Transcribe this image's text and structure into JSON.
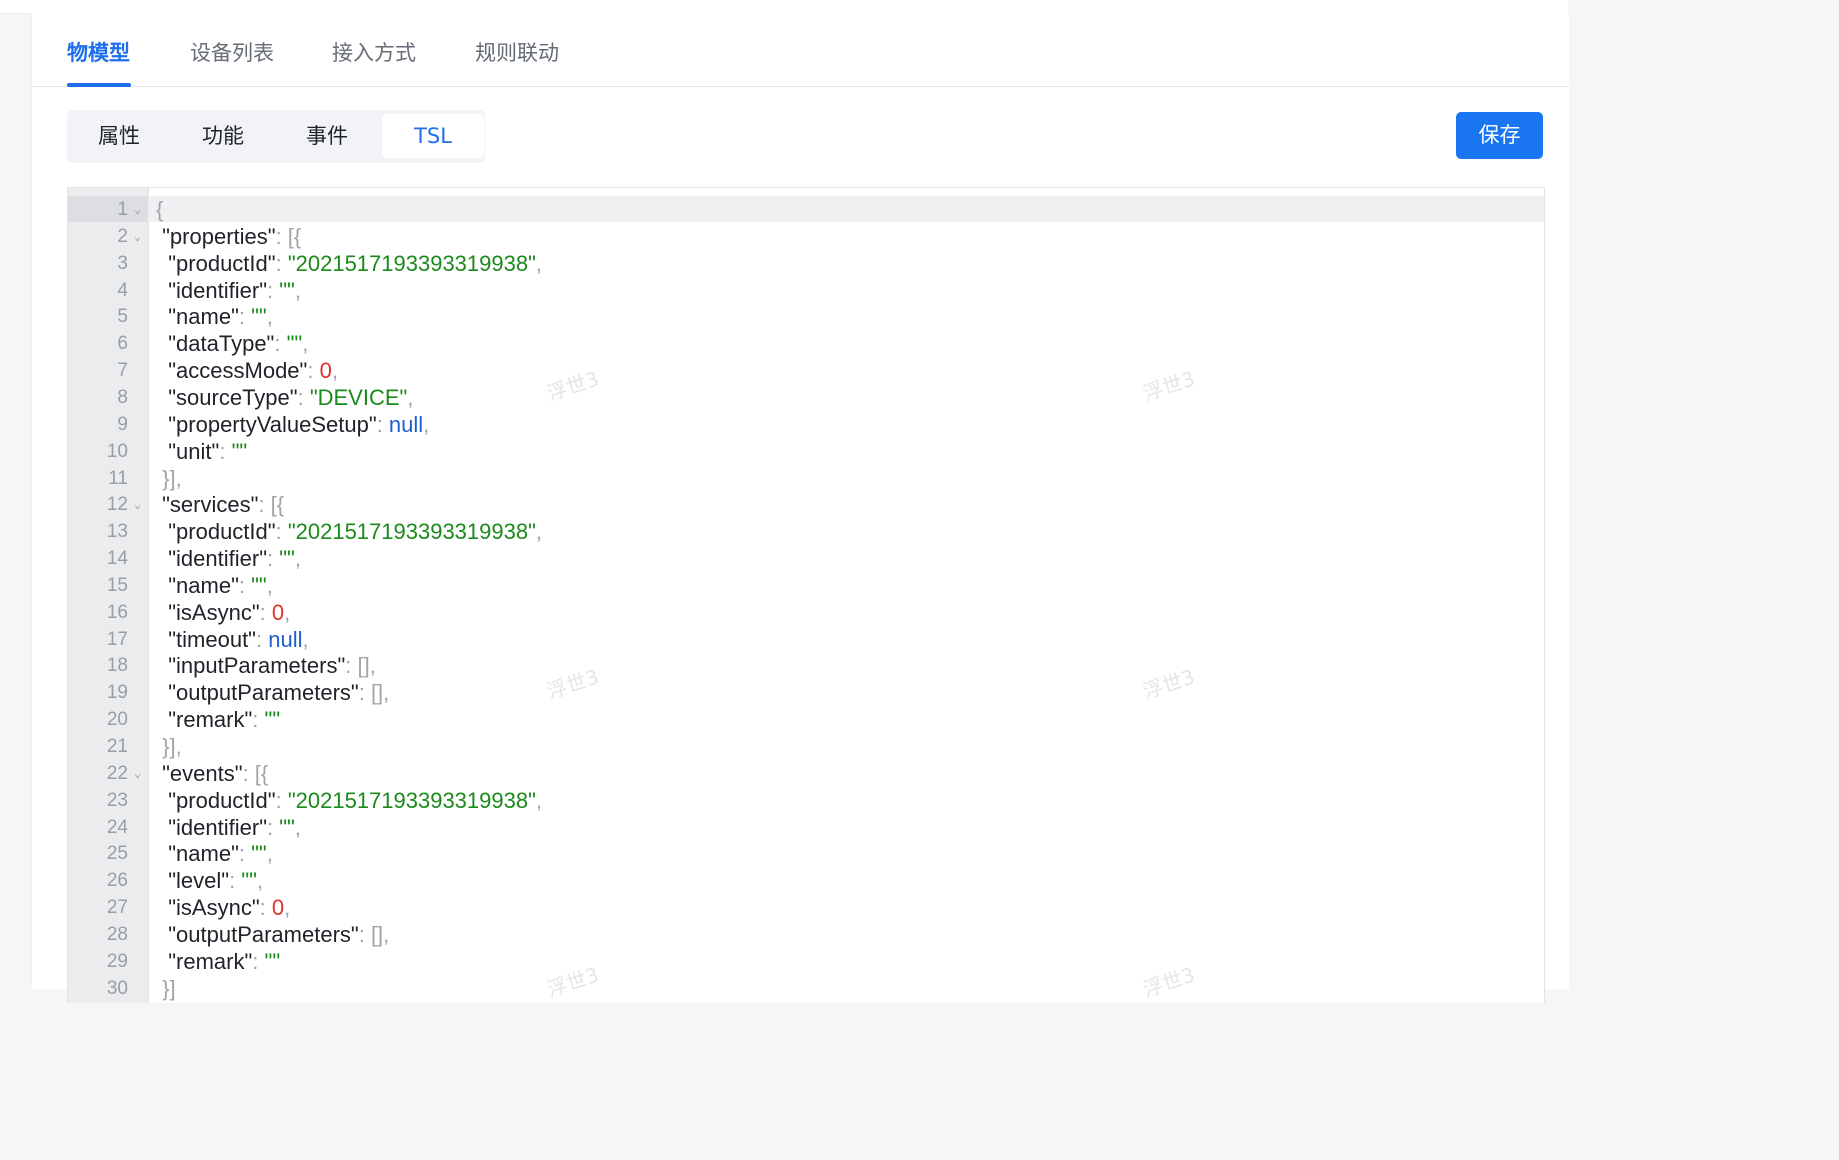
{
  "main_tabs": [
    "物模型",
    "设备列表",
    "接入方式",
    "规则联动"
  ],
  "active_main_tab": "物模型",
  "sub_tabs": [
    "属性",
    "功能",
    "事件",
    "TSL"
  ],
  "active_sub_tab": "TSL",
  "save_label": "保存",
  "watermark": "浮世3",
  "editor": {
    "lines": [
      {
        "n": "1",
        "fold": true,
        "t": [
          [
            "p",
            "{"
          ]
        ]
      },
      {
        "n": "2",
        "fold": true,
        "t": [
          [
            "k",
            " \"properties\""
          ],
          [
            "p",
            ": [{"
          ]
        ]
      },
      {
        "n": "3",
        "t": [
          [
            "k",
            "  \"productId\""
          ],
          [
            "p",
            ": "
          ],
          [
            "s",
            "\"2021517193393319938\""
          ],
          [
            "p",
            ","
          ]
        ]
      },
      {
        "n": "4",
        "t": [
          [
            "k",
            "  \"identifier\""
          ],
          [
            "p",
            ": "
          ],
          [
            "s",
            "\"\""
          ],
          [
            "p",
            ","
          ]
        ]
      },
      {
        "n": "5",
        "t": [
          [
            "k",
            "  \"name\""
          ],
          [
            "p",
            ": "
          ],
          [
            "s",
            "\"\""
          ],
          [
            "p",
            ","
          ]
        ]
      },
      {
        "n": "6",
        "t": [
          [
            "k",
            "  \"dataType\""
          ],
          [
            "p",
            ": "
          ],
          [
            "s",
            "\"\""
          ],
          [
            "p",
            ","
          ]
        ]
      },
      {
        "n": "7",
        "t": [
          [
            "k",
            "  \"accessMode\""
          ],
          [
            "p",
            ": "
          ],
          [
            "n",
            "0"
          ],
          [
            "p",
            ","
          ]
        ]
      },
      {
        "n": "8",
        "t": [
          [
            "k",
            "  \"sourceType\""
          ],
          [
            "p",
            ": "
          ],
          [
            "s",
            "\"DEVICE\""
          ],
          [
            "p",
            ","
          ]
        ]
      },
      {
        "n": "9",
        "t": [
          [
            "k",
            "  \"propertyValueSetup\""
          ],
          [
            "p",
            ": "
          ],
          [
            "l",
            "null"
          ],
          [
            "p",
            ","
          ]
        ]
      },
      {
        "n": "10",
        "t": [
          [
            "k",
            "  \"unit\""
          ],
          [
            "p",
            ": "
          ],
          [
            "s",
            "\"\""
          ]
        ]
      },
      {
        "n": "11",
        "t": [
          [
            "p",
            " }],"
          ]
        ]
      },
      {
        "n": "12",
        "fold": true,
        "t": [
          [
            "k",
            " \"services\""
          ],
          [
            "p",
            ": [{"
          ]
        ]
      },
      {
        "n": "13",
        "t": [
          [
            "k",
            "  \"productId\""
          ],
          [
            "p",
            ": "
          ],
          [
            "s",
            "\"2021517193393319938\""
          ],
          [
            "p",
            ","
          ]
        ]
      },
      {
        "n": "14",
        "t": [
          [
            "k",
            "  \"identifier\""
          ],
          [
            "p",
            ": "
          ],
          [
            "s",
            "\"\""
          ],
          [
            "p",
            ","
          ]
        ]
      },
      {
        "n": "15",
        "t": [
          [
            "k",
            "  \"name\""
          ],
          [
            "p",
            ": "
          ],
          [
            "s",
            "\"\""
          ],
          [
            "p",
            ","
          ]
        ]
      },
      {
        "n": "16",
        "t": [
          [
            "k",
            "  \"isAsync\""
          ],
          [
            "p",
            ": "
          ],
          [
            "n",
            "0"
          ],
          [
            "p",
            ","
          ]
        ]
      },
      {
        "n": "17",
        "t": [
          [
            "k",
            "  \"timeout\""
          ],
          [
            "p",
            ": "
          ],
          [
            "l",
            "null"
          ],
          [
            "p",
            ","
          ]
        ]
      },
      {
        "n": "18",
        "t": [
          [
            "k",
            "  \"inputParameters\""
          ],
          [
            "p",
            ": [],"
          ]
        ]
      },
      {
        "n": "19",
        "t": [
          [
            "k",
            "  \"outputParameters\""
          ],
          [
            "p",
            ": [],"
          ]
        ]
      },
      {
        "n": "20",
        "t": [
          [
            "k",
            "  \"remark\""
          ],
          [
            "p",
            ": "
          ],
          [
            "s",
            "\"\""
          ]
        ]
      },
      {
        "n": "21",
        "t": [
          [
            "p",
            " }],"
          ]
        ]
      },
      {
        "n": "22",
        "fold": true,
        "t": [
          [
            "k",
            " \"events\""
          ],
          [
            "p",
            ": [{"
          ]
        ]
      },
      {
        "n": "23",
        "t": [
          [
            "k",
            "  \"productId\""
          ],
          [
            "p",
            ": "
          ],
          [
            "s",
            "\"2021517193393319938\""
          ],
          [
            "p",
            ","
          ]
        ]
      },
      {
        "n": "24",
        "t": [
          [
            "k",
            "  \"identifier\""
          ],
          [
            "p",
            ": "
          ],
          [
            "s",
            "\"\""
          ],
          [
            "p",
            ","
          ]
        ]
      },
      {
        "n": "25",
        "t": [
          [
            "k",
            "  \"name\""
          ],
          [
            "p",
            ": "
          ],
          [
            "s",
            "\"\""
          ],
          [
            "p",
            ","
          ]
        ]
      },
      {
        "n": "26",
        "t": [
          [
            "k",
            "  \"level\""
          ],
          [
            "p",
            ": "
          ],
          [
            "s",
            "\"\""
          ],
          [
            "p",
            ","
          ]
        ]
      },
      {
        "n": "27",
        "t": [
          [
            "k",
            "  \"isAsync\""
          ],
          [
            "p",
            ": "
          ],
          [
            "n",
            "0"
          ],
          [
            "p",
            ","
          ]
        ]
      },
      {
        "n": "28",
        "t": [
          [
            "k",
            "  \"outputParameters\""
          ],
          [
            "p",
            ": [],"
          ]
        ]
      },
      {
        "n": "29",
        "t": [
          [
            "k",
            "  \"remark\""
          ],
          [
            "p",
            ": "
          ],
          [
            "s",
            "\"\""
          ]
        ]
      },
      {
        "n": "30",
        "t": [
          [
            "p",
            " }]"
          ]
        ]
      }
    ]
  },
  "colors": {
    "accent": "#1f6fec",
    "button": "#1976f0",
    "string": "#1a8a1a",
    "number": "#e0322d",
    "literal": "#1f5fd0"
  }
}
